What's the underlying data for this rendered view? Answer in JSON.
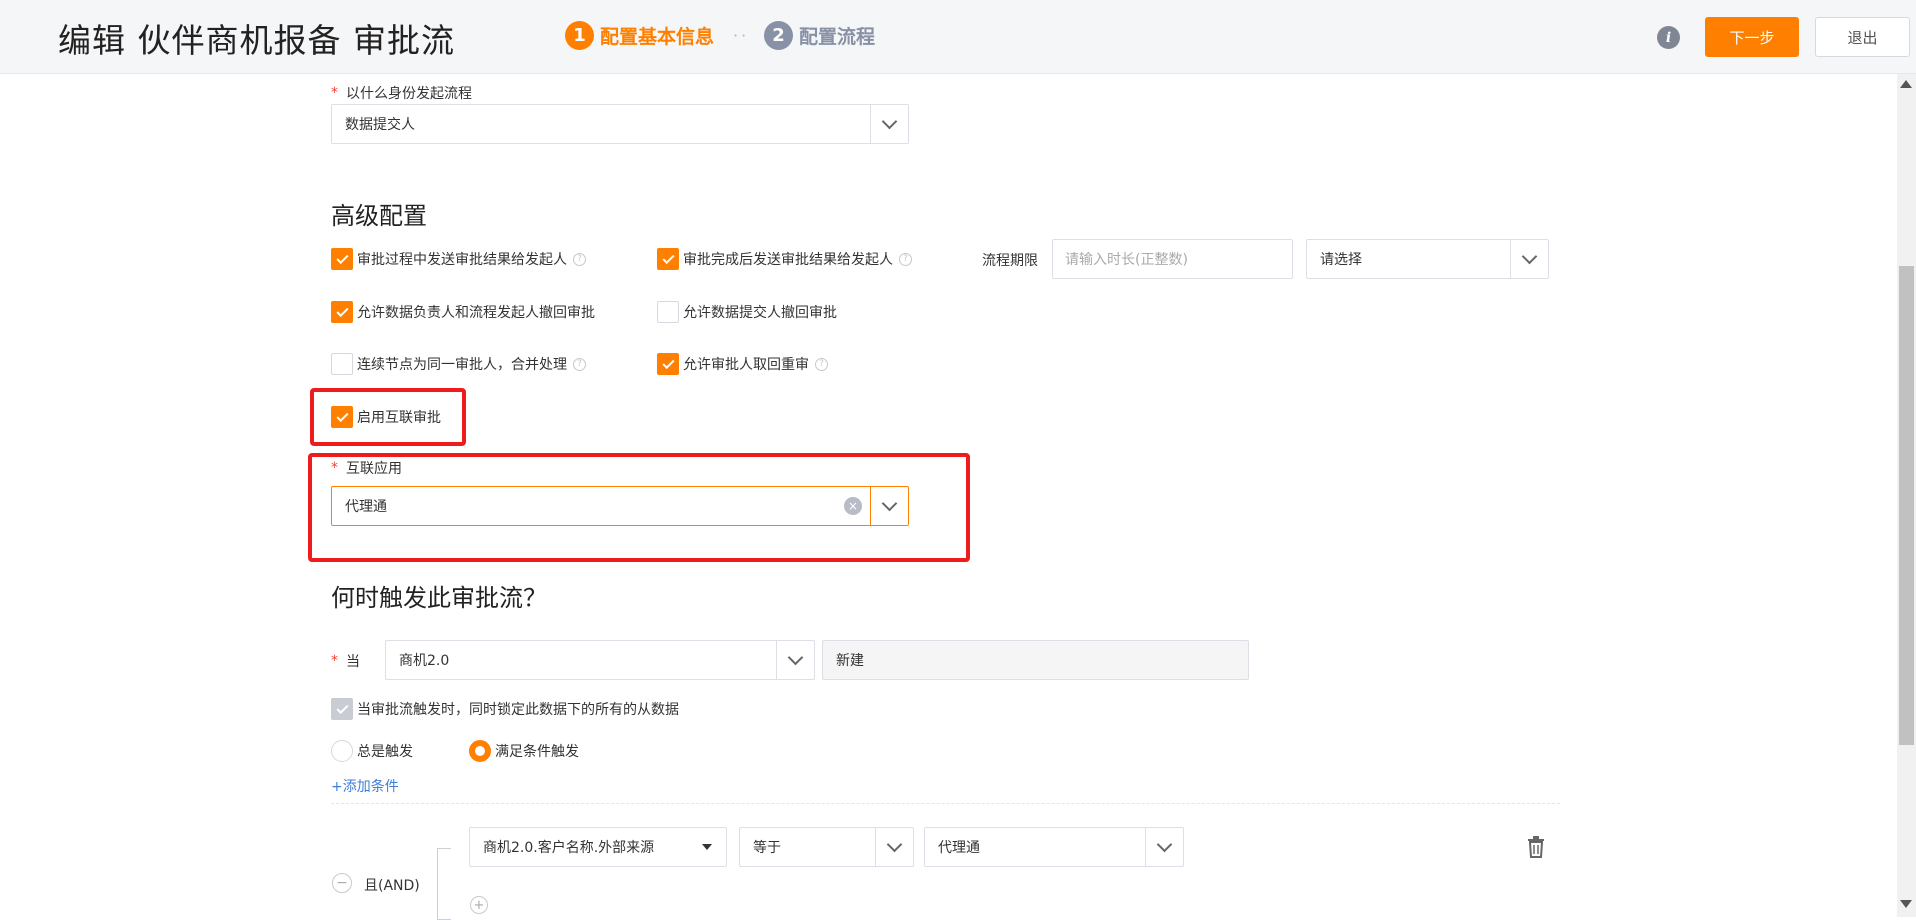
{
  "header": {
    "title": "编辑 伙伴商机报备 审批流",
    "steps": [
      {
        "num": "1",
        "label": "配置基本信息",
        "color": "#ff8000"
      },
      {
        "num": "2",
        "label": "配置流程",
        "color": "#8891a6"
      }
    ],
    "dots": "··",
    "info": "i",
    "next_label": "下一步",
    "exit_label": "退出"
  },
  "initiator": {
    "required": "*",
    "label": "以什么身份发起流程",
    "value": "数据提交人"
  },
  "advanced": {
    "title": "高级配置",
    "options": [
      {
        "label": "审批过程中发送审批结果给发起人",
        "checked": true,
        "help": true
      },
      {
        "label": "审批完成后发送审批结果给发起人",
        "checked": true,
        "help": true
      },
      {
        "label": "允许数据负责人和流程发起人撤回审批",
        "checked": true,
        "help": false
      },
      {
        "label": "允许数据提交人撤回审批",
        "checked": false,
        "help": false
      },
      {
        "label": "连续节点为同一审批人，合并处理",
        "checked": false,
        "help": true
      },
      {
        "label": "允许审批人取回重审",
        "checked": true,
        "help": true
      }
    ],
    "deadline_label": "流程期限",
    "deadline_placeholder": "请输入时长(正整数)",
    "deadline_unit_placeholder": "请选择",
    "interconnect_label": "启用互联审批",
    "interconnect_checked": true,
    "app_required": "*",
    "app_label": "互联应用",
    "app_value": "代理通"
  },
  "trigger": {
    "title": "何时触发此审批流？",
    "required": "*",
    "when_label": "当",
    "object_value": "商机2.0",
    "event_value": "新建",
    "lock_label": "当审批流触发时，同时锁定此数据下的所有的从数据",
    "always_label": "总是触发",
    "conditional_label": "满足条件触发",
    "add_condition": "+添加条件",
    "and_label": "且(AND)",
    "condition": {
      "field": "商机2.0.客户名称.外部来源",
      "operator": "等于",
      "value": "代理通"
    }
  },
  "colors": {
    "accent": "#ff8000",
    "highlight": "#ee1c1c",
    "link": "#3d7fd9"
  }
}
